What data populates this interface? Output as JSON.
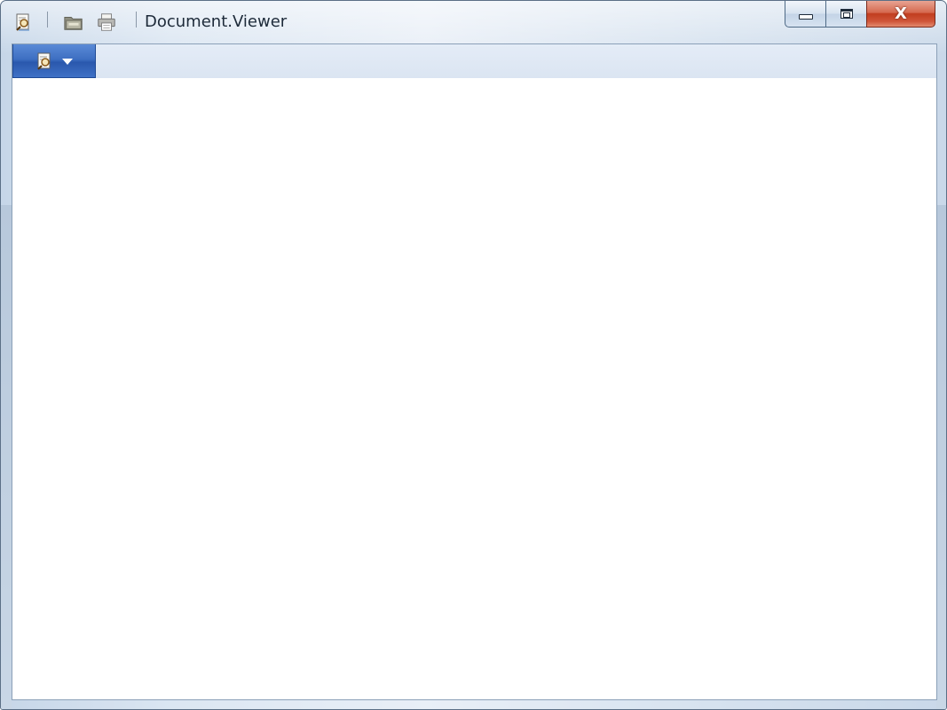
{
  "window": {
    "title": "Document.Viewer"
  },
  "title_bar": {
    "app_icon": "document-search-icon",
    "quick_access": [
      {
        "name": "open",
        "icon": "open-folder-icon"
      },
      {
        "name": "print",
        "icon": "printer-icon"
      }
    ]
  },
  "caption_buttons": {
    "minimize_icon": "minimize-icon",
    "maximize_icon": "restore-icon",
    "close_label": "X"
  },
  "ribbon": {
    "application_menu_icon": "document-search-icon",
    "application_menu_dropdown": "chevron-down-icon"
  },
  "colors": {
    "accent_blue": "#3e6fc2",
    "close_red": "#c13d1f",
    "frame": "#dbe6f2",
    "client_background": "#ffffff"
  }
}
